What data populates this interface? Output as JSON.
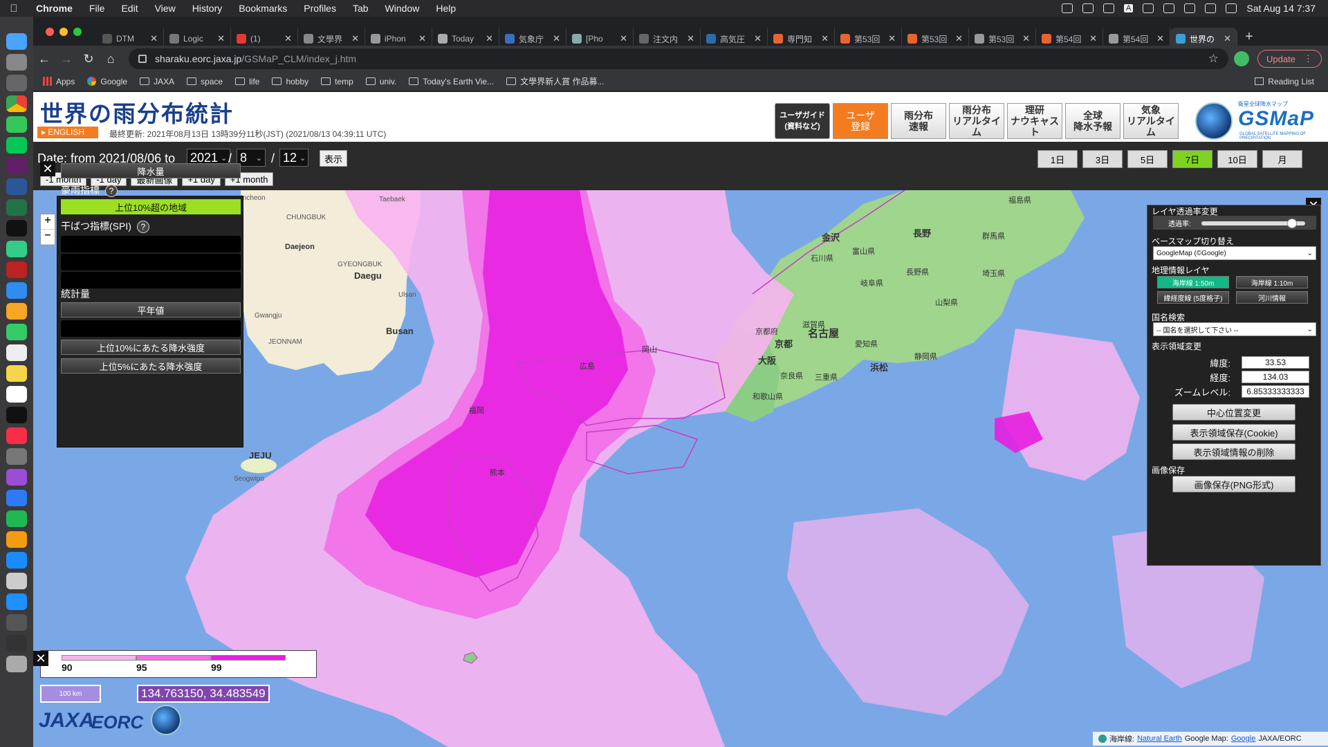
{
  "os_menubar": {
    "app": "Chrome",
    "items": [
      "File",
      "Edit",
      "View",
      "History",
      "Bookmarks",
      "Profiles",
      "Tab",
      "Window",
      "Help"
    ],
    "datetime": "Sat Aug 14  7:37",
    "input_indicator": "A"
  },
  "browser": {
    "tabs": [
      {
        "label": "DTM",
        "color": "#555"
      },
      {
        "label": "Logic",
        "color": "#777"
      },
      {
        "label": "(1)",
        "color": "#e53935"
      },
      {
        "label": "文學界",
        "color": "#888"
      },
      {
        "label": "iPhon",
        "color": "#999"
      },
      {
        "label": "Today",
        "color": "#aaa"
      },
      {
        "label": "気象庁",
        "color": "#3a6fbf"
      },
      {
        "label": "[Pho",
        "color": "#8aa"
      },
      {
        "label": "注文内",
        "color": "#666"
      },
      {
        "label": "高気圧",
        "color": "#2b6cb0"
      },
      {
        "label": "専門知",
        "color": "#e8642c"
      },
      {
        "label": "第53回",
        "color": "#e8642c"
      },
      {
        "label": "第53回",
        "color": "#e8642c"
      },
      {
        "label": "第53回",
        "color": "#999"
      },
      {
        "label": "第54回",
        "color": "#e8642c"
      },
      {
        "label": "第54回",
        "color": "#999"
      },
      {
        "label": "世界の",
        "color": "#3aa0d8",
        "active": true
      }
    ],
    "url_host": "sharaku.eorc.jaxa.jp",
    "url_path": "/GSMaP_CLM/index_j.htm",
    "update_label": "Update",
    "bookmarks": [
      {
        "label": "Apps",
        "kind": "grid"
      },
      {
        "label": "Google",
        "kind": "google"
      },
      {
        "label": "JAXA",
        "kind": "folder"
      },
      {
        "label": "space",
        "kind": "folder"
      },
      {
        "label": "life",
        "kind": "folder"
      },
      {
        "label": "hobby",
        "kind": "folder"
      },
      {
        "label": "temp",
        "kind": "folder"
      },
      {
        "label": "univ.",
        "kind": "folder"
      },
      {
        "label": "Today's Earth Vie...",
        "kind": "folder"
      },
      {
        "label": "文學界新人賞 作品募...",
        "kind": "folder"
      }
    ],
    "reading_list": "Reading List"
  },
  "site": {
    "title": "世界の雨分布統計",
    "english": "▸ ENGLISH",
    "updated": "最終更新: 2021年08月13日 13時39分11秒(JST) (2021/08/13 04:39:11 UTC)",
    "header_buttons": [
      {
        "label": "ユーザガイド\n(資料など)",
        "style": "dark"
      },
      {
        "label": "ユーザ\n登録",
        "style": "orange"
      },
      {
        "label": "雨分布\n速報",
        "style": "normal"
      },
      {
        "label": "雨分布\nリアルタイム",
        "style": "normal"
      },
      {
        "label": "理研\nナウキャスト",
        "style": "normal"
      },
      {
        "label": "全球\n降水予報",
        "style": "normal"
      },
      {
        "label": "気象\nリアルタイム",
        "style": "normal"
      }
    ],
    "logo_text": "GSMaP",
    "logo_sub": "GLOBAL SATELLITE MAPPING OF PRECIPITATION",
    "logo_top": "衛星全球降水マップ"
  },
  "datebar": {
    "label": "Date: from 2021/08/06 to",
    "year": "2021",
    "month": "8",
    "day": "12",
    "slash": "/",
    "show": "表示",
    "nav": [
      "-1 month",
      "-1 day",
      "最新画像",
      "+1 day",
      "+1 month"
    ],
    "periods": [
      {
        "label": "1日"
      },
      {
        "label": "3日"
      },
      {
        "label": "5日"
      },
      {
        "label": "7日",
        "active": true
      },
      {
        "label": "10日"
      },
      {
        "label": "月"
      }
    ]
  },
  "legend_panel": {
    "top_button": "降水量",
    "heavy_label": "豪雨指標",
    "heavy_button": "上位10%超の地域",
    "drought_label": "干ばつ指標(SPI)",
    "stats_label": "統計量",
    "stat_buttons": [
      "平年値",
      "上位10%にあたる降水強度",
      "上位5%にあたる降水強度"
    ],
    "help": "?"
  },
  "right_panel": {
    "opacity_label": "レイヤ透過率変更",
    "opacity_sub": "透過率:",
    "opacity_value": 0.87,
    "basemap_label": "ベースマップ切り替え",
    "basemap_value": "GoogleMap (©Google)",
    "geo_label": "地理情報レイヤ",
    "geo_buttons": [
      {
        "label": "海岸線 1:50m",
        "on": true
      },
      {
        "label": "海岸線 1:10m",
        "on": false
      },
      {
        "label": "緯経度線 (5度格子)",
        "on": false
      },
      {
        "label": "河川情報",
        "on": false
      }
    ],
    "country_label": "国名検索",
    "country_placeholder": "-- 国名を選択して下さい --",
    "view_label": "表示領域変更",
    "lat_label": "緯度:",
    "lat_value": "33.53",
    "lon_label": "経度:",
    "lon_value": "134.03",
    "zoom_label": "ズームレベル:",
    "zoom_value": "6.85333333333",
    "center_btn": "中心位置変更",
    "save_btn": "表示領域保存(Cookie)",
    "delete_btn": "表示領域情報の削除",
    "image_label": "画像保存",
    "png_btn": "画像保存(PNG形式)"
  },
  "map": {
    "legend_ticks": [
      "90",
      "95",
      "99"
    ],
    "scale": "100 km",
    "coords": "134.763150, 34.483549",
    "logo_jaxa": "JAXA",
    "logo_eorc": "EORC",
    "attribution_prefix": "海岸線:",
    "attribution_ne": "Natural Earth",
    "attribution_gm": "Google Map:",
    "attribution_google": "Google",
    "attribution_suffix": "JAXA/EORC",
    "labels": {
      "seoul_area": "Incheon",
      "chungbuk": "CHUNGBUK",
      "gangwon": "Taebaek",
      "daejeon": "Daejeon",
      "daegu": "Daegu",
      "ulsan": "Ulsan",
      "busan": "Busan",
      "gwangju": "Gwangju",
      "jeju": "JEJU",
      "seogwipo": "Seogwipo",
      "gyeongbuk": "GYEONGBUK",
      "jeonnam": "JEONNAM",
      "kyoto": "京都",
      "nagoya": "名古屋",
      "osaka": "大阪",
      "hamamatsu": "浜松",
      "nagano": "長野",
      "kanazawa": "金沢",
      "gunma": "群馬県",
      "saitama": "埼玉県",
      "toyama": "富山県",
      "ishikawa": "石川県",
      "gifu": "岐阜県",
      "shizuoka": "静岡県",
      "aichi": "愛知県",
      "mie": "三重県",
      "fukushima": "福島県",
      "okayama": "岡山",
      "hiroshima": "広島",
      "fukuoka": "福岡",
      "kumamoto": "熊本",
      "yamanashi": "山梨県",
      "naganoken": "長野県",
      "wakayama": "和歌山県",
      "nara": "奈良県",
      "shiga": "滋賀県",
      "kyotofu": "京都府"
    }
  },
  "colors": {
    "level90": "#f7b4f0",
    "level95": "#f36ee8",
    "level99": "#e61ee0",
    "ocean": "#7aa8e6",
    "accent_orange": "#f47c20",
    "accent_green": "#9be021"
  }
}
